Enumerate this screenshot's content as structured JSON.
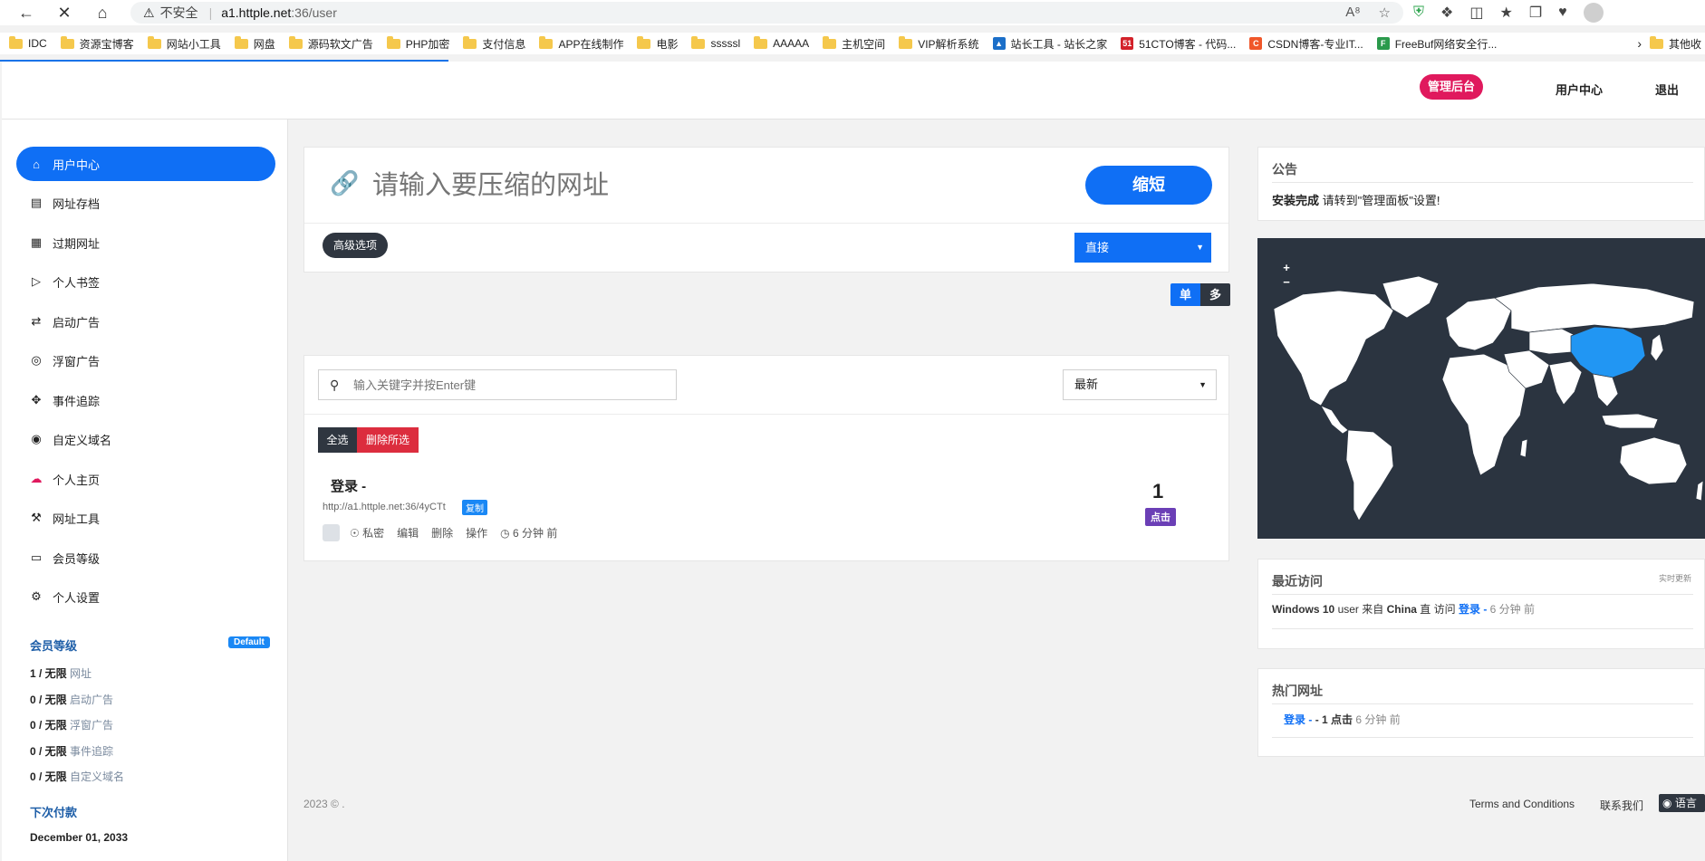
{
  "browser": {
    "insecure_label": "不安全",
    "url_host": "a1.httple.net",
    "url_path": ":36/user",
    "bookmarks": [
      "IDC",
      "资源宝博客",
      "网站小工具",
      "网盘",
      "源码软文广告",
      "PHP加密",
      "支付信息",
      "APP在线制作",
      "电影",
      "sssssl",
      "AAAAA",
      "主机空间",
      "VIP解析系统",
      "站长工具 - 站长之家",
      "51CTO博客 - 代码...",
      "CSDN博客-专业IT...",
      "FreeBuf网络安全行..."
    ],
    "bookmarks_other": "其他收"
  },
  "header": {
    "admin_label": "管理后台",
    "user_center_label": "用户中心",
    "logout_label": "退出"
  },
  "sidebar": {
    "items": [
      {
        "label": "用户中心",
        "icon": "home-icon"
      },
      {
        "label": "网址存档",
        "icon": "briefcase-icon"
      },
      {
        "label": "过期网址",
        "icon": "calendar-icon"
      },
      {
        "label": "个人书签",
        "icon": "folder-open-icon"
      },
      {
        "label": "启动广告",
        "icon": "swap-icon"
      },
      {
        "label": "浮窗广告",
        "icon": "target-icon"
      },
      {
        "label": "事件追踪",
        "icon": "crosshair-icon"
      },
      {
        "label": "自定义域名",
        "icon": "globe-icon"
      },
      {
        "label": "个人主页",
        "icon": "cloud-icon"
      },
      {
        "label": "网址工具",
        "icon": "wrench-icon"
      },
      {
        "label": "会员等级",
        "icon": "card-icon"
      },
      {
        "label": "个人设置",
        "icon": "gear-icon"
      }
    ],
    "membership_title": "会员等级",
    "membership_badge": "Default",
    "quotas": [
      {
        "value": "1 / 无限",
        "label": "网址"
      },
      {
        "value": "0 / 无限",
        "label": "启动广告"
      },
      {
        "value": "0 / 无限",
        "label": "浮窗广告"
      },
      {
        "value": "0 / 无限",
        "label": "事件追踪"
      },
      {
        "value": "0 / 无限",
        "label": "自定义域名"
      }
    ],
    "next_payment_title": "下次付款",
    "next_payment_date": "December 01, 2033"
  },
  "shortener": {
    "placeholder": "请输入要压缩的网址",
    "shorten_label": "缩短",
    "advanced_label": "高级选项",
    "redirect_type": "直接",
    "mode_single": "单",
    "mode_multi": "多"
  },
  "links": {
    "search_placeholder": "输入关键字并按Enter键",
    "sort_value": "最新",
    "select_all": "全选",
    "delete_selected": "删除所选",
    "items": [
      {
        "title": "登录 -",
        "short_url": "http://a1.httple.net:36/4yCTt",
        "copy_label": "复制",
        "private_label": "私密",
        "edit_label": "编辑",
        "delete_label": "删除",
        "actions_label": "操作",
        "time": "6 分钟 前",
        "clicks": "1",
        "clicks_label": "点击"
      }
    ]
  },
  "notice": {
    "title": "公告",
    "bold": "安装完成",
    "text": " 请转到\"管理面板\"设置!"
  },
  "map": {
    "zoom_in": "+",
    "zoom_out": "−",
    "highlight_color": "#2196f3"
  },
  "recent": {
    "title": "最近访问",
    "realtime_label": "实时更新",
    "os": "Windows 10",
    "from_text": "user 来自",
    "country": "China",
    "direct_text": "直 访问",
    "link": "登录 -",
    "time": "6 分钟 前"
  },
  "hot": {
    "title": "热门网址",
    "link": "登录 -",
    "clicks": "- 1 点击",
    "time": "6 分钟 前"
  },
  "footer": {
    "copyright": "2023 © .",
    "terms": "Terms and Conditions",
    "contact": "联系我们",
    "language": "语言"
  }
}
